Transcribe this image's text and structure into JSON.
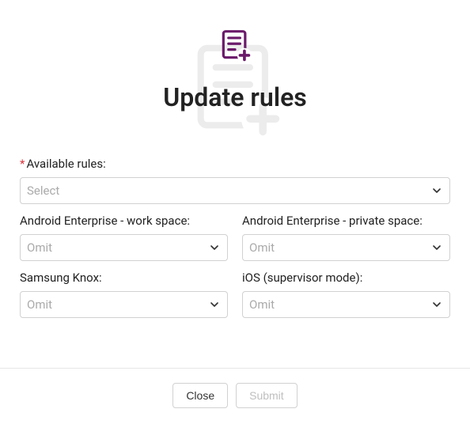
{
  "header": {
    "title": "Update rules"
  },
  "form": {
    "available_rules": {
      "label": "Available rules:",
      "required": true,
      "placeholder": "Select"
    },
    "android_work": {
      "label": "Android Enterprise - work space:",
      "placeholder": "Omit"
    },
    "android_private": {
      "label": "Android Enterprise - private space:",
      "placeholder": "Omit"
    },
    "samsung_knox": {
      "label": "Samsung Knox:",
      "placeholder": "Omit"
    },
    "ios_supervisor": {
      "label": "iOS (supervisor mode):",
      "placeholder": "Omit"
    }
  },
  "footer": {
    "close_label": "Close",
    "submit_label": "Submit"
  },
  "colors": {
    "accent": "#6b1a6b"
  }
}
